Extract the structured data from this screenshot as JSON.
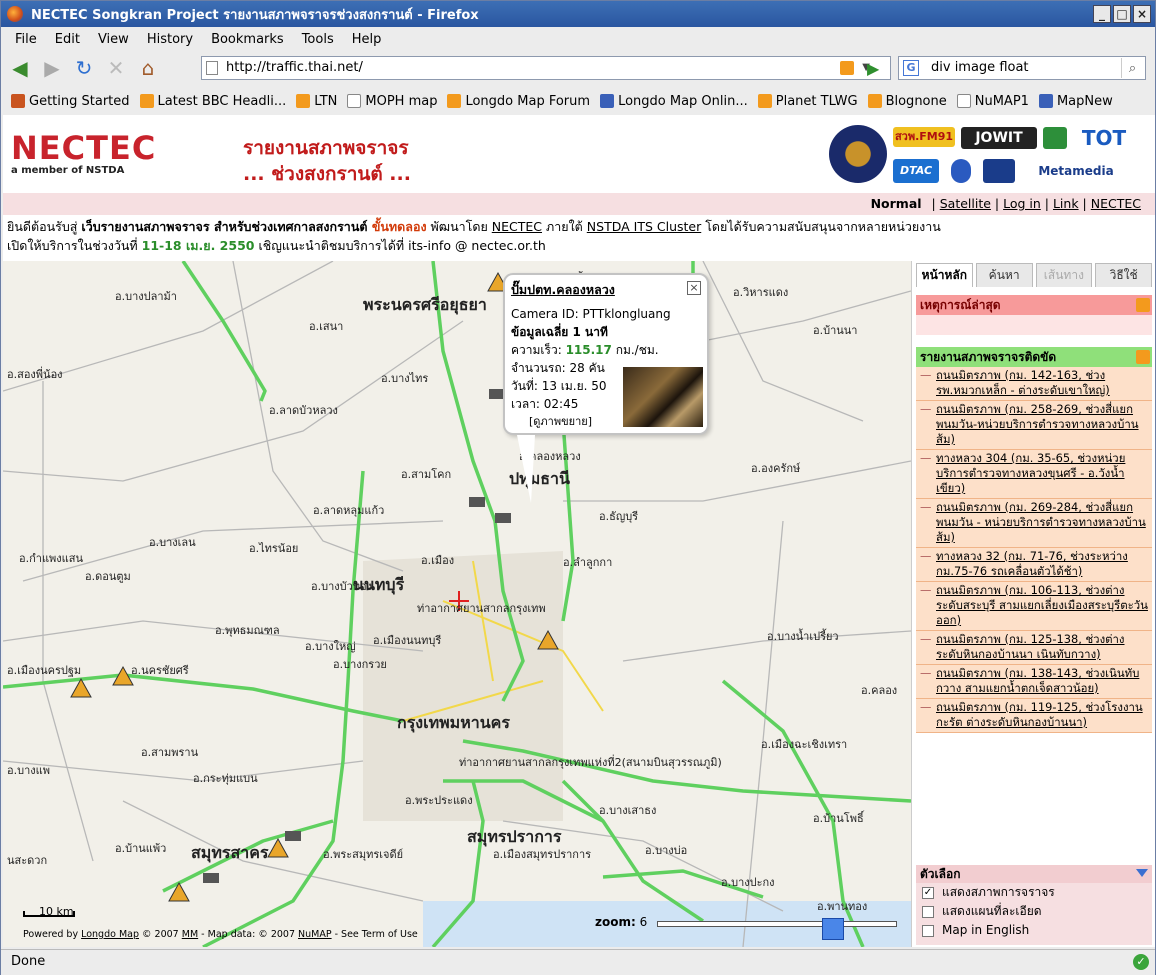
{
  "window": {
    "title": "NECTEC Songkran Project รายงานสภาพจราจรช่วงสงกรานต์ - Firefox"
  },
  "menu": [
    "File",
    "Edit",
    "View",
    "History",
    "Bookmarks",
    "Tools",
    "Help"
  ],
  "url": "http://traffic.thai.net/",
  "search_value": "div image float",
  "bookmarks": [
    {
      "label": "Getting Started",
      "icon": "ff"
    },
    {
      "label": "Latest BBC Headli...",
      "icon": "rss"
    },
    {
      "label": "LTN",
      "icon": "rss"
    },
    {
      "label": "MOPH map",
      "icon": "page"
    },
    {
      "label": "Longdo Map Forum",
      "icon": "rss"
    },
    {
      "label": "Longdo Map Onlin...",
      "icon": "lm"
    },
    {
      "label": "Planet TLWG",
      "icon": "rss"
    },
    {
      "label": "Blognone",
      "icon": "rss"
    },
    {
      "label": "NuMAP1",
      "icon": "page"
    },
    {
      "label": "MapNew",
      "icon": "lm"
    }
  ],
  "header": {
    "logo_text": "NECTEC",
    "logo_sub": "a member of NSTDA",
    "title_line1": "รายงานสภาพจราจร",
    "title_line2": "... ช่วงสงกรานต์ ...",
    "sponsors": [
      "สวพ.FM91",
      "JOWIT",
      "TOT",
      "DTAC",
      "Metamedia"
    ]
  },
  "modebar": {
    "current": "Normal",
    "links": [
      "Satellite",
      "Log in",
      "Link",
      "NECTEC"
    ]
  },
  "welcome": {
    "line1_a": "ยินดีต้อนรับสู่ ",
    "line1_b": "เว็บรายงานสภาพจราจร สำหรับช่วงเทศกาลสงกรานต์",
    "line1_c": " ขั้นทดลอง",
    "line1_d": " พัฒนาโดย ",
    "line1_e": "NECTEC",
    "line1_f": " ภายใต้ ",
    "line1_g": "NSTDA ITS Cluster",
    "line1_h": " โดยได้รับความสนับสนุนจากหลายหน่วยงาน",
    "line2_a": "เปิดให้บริการในช่วงวันที่ ",
    "line2_b": "11-18 เม.ย. 2550",
    "line2_c": " เชิญแนะนำติชมบริการได้ที่ its-info @ nectec.or.th"
  },
  "popup": {
    "title": "ปั๊มปตท.คลองหลวง",
    "camera": "Camera ID: PTTklongluang",
    "avg": "ข้อมูลเฉลี่ย 1 นาที",
    "speed_label": "ความเร็ว: ",
    "speed": "115.17",
    "speed_unit": " กม./ชม.",
    "cars": "จำนวนรถ: 28 คัน",
    "date": "วันที่: 13 เม.ย. 50",
    "time": "เวลา: 02:45",
    "enlarge": "[ดูภาพขยาย]"
  },
  "map": {
    "zoom_label": "zoom:",
    "zoom_value": "6",
    "scale": "10 km",
    "credit_a": "Powered by ",
    "credit_b": "Longdo Map",
    "credit_c": " © 2007 ",
    "credit_d": "MM",
    "credit_e": " - Map data: © 2007 ",
    "credit_f": "NuMAP",
    "credit_g": " - See Term of Use",
    "labels": [
      {
        "t": "พระนครศรีอยุธยา",
        "big": true
      },
      {
        "t": "ปทุมธานี",
        "big": true
      },
      {
        "t": "นนทบุรี",
        "big": true
      },
      {
        "t": "กรุงเทพมหานคร",
        "big": true
      },
      {
        "t": "สมุทรปราการ",
        "big": true
      },
      {
        "t": "สมุทรสาคร",
        "big": true
      },
      {
        "t": "อ.บางปลาม้า"
      },
      {
        "t": "อ.บางซ้าย"
      },
      {
        "t": "อ.เสนา"
      },
      {
        "t": "อ.สองพี่น้อง"
      },
      {
        "t": "อ.บางไทร"
      },
      {
        "t": "อ.ลาดบัวหลวง"
      },
      {
        "t": "อ.สามโคก"
      },
      {
        "t": "อ.คลองหลวง"
      },
      {
        "t": "อ.ลาดหลุมแก้ว"
      },
      {
        "t": "อ.ธัญบุรี"
      },
      {
        "t": "อ.บางเลน"
      },
      {
        "t": "อ.ไทรน้อย"
      },
      {
        "t": "อ.กำแพงแสน"
      },
      {
        "t": "อ.ดอนตูม"
      },
      {
        "t": "อ.เมือง"
      },
      {
        "t": "อ.ลำลูกกา"
      },
      {
        "t": "อ.บางบัวทอง"
      },
      {
        "t": "ท่าอากาศยานสากลกรุงเทพ"
      },
      {
        "t": "อ.พุทธมณฑล"
      },
      {
        "t": "อ.บางใหญ่"
      },
      {
        "t": "อ.เมืองนนทบุรี"
      },
      {
        "t": "อ.บางกรวย"
      },
      {
        "t": "อ.เมืองนครปฐม"
      },
      {
        "t": "อ.นครชัยศรี"
      },
      {
        "t": "อ.สามพราน"
      },
      {
        "t": "อ.กระทุ่มแบน"
      },
      {
        "t": "ท่าอากาศยานสากลกรุงเทพแห่งที่2(สนามบินสุวรรณภูมิ)"
      },
      {
        "t": "อ.พระประแดง"
      },
      {
        "t": "อ.บางเสาธง"
      },
      {
        "t": "อ.บ้านแพ้ว"
      },
      {
        "t": "อ.พระสมุทรเจดีย์"
      },
      {
        "t": "อ.เมืองสมุทรปราการ"
      },
      {
        "t": "อ.บางบ่อ"
      },
      {
        "t": "อ.บางปะกง"
      },
      {
        "t": "อ.พานทอง"
      },
      {
        "t": "อ.บ้านโพธิ์"
      },
      {
        "t": "อ.เมืองฉะเชิงเทรา"
      },
      {
        "t": "อ.บางน้ำเปรี้ยว"
      },
      {
        "t": "อ.องครักษ์"
      },
      {
        "t": "อ.วิหารแดง"
      },
      {
        "t": "อ.บ้านนา"
      },
      {
        "t": "อ.คลอง"
      },
      {
        "t": "อ.บางแพ"
      },
      {
        "t": "นสะดวก"
      }
    ]
  },
  "sidebar": {
    "tabs": [
      "หน้าหลัก",
      "ค้นหา",
      "เส้นทาง",
      "วิธีใช้"
    ],
    "incidents_title": "เหตุการณ์ล่าสุด",
    "traffic_title": "รายงานสภาพจราจรติดขัด",
    "traffic_items": [
      "ถนนมิตรภาพ (กม. 142-163, ช่วง รพ.หมวกเหล็ก - ต่างระดับเขาใหญ่)",
      "ถนนมิตรภาพ (กม. 258-269, ช่วงสี่แยกพนมวัน-หน่วยบริการตำรวจทางหลวงบ้านส้ม)",
      "ทางหลวง 304 (กม. 35-65, ช่วงหน่วยบริการตำรวจทางหลวงขุนศรี - อ.วังน้ำเขียว)",
      "ถนนมิตรภาพ (กม. 269-284, ช่วงสี่แยกพนมวัน - หน่วยบริการตำรวจทางหลวงบ้านส้ม)",
      "ทางหลวง 32 (กม. 71-76, ช่วงระหว่าง กม.75-76 รถเคลื่อนตัวได้ช้า)",
      "ถนนมิตรภาพ (กม. 106-113, ช่วงต่างระดับสระบุรี สามแยกเลี่ยงเมืองสระบุรีตะวันออก)",
      "ถนนมิตรภาพ (กม. 125-138, ช่วงต่างระดับหินกองบ้านนา เนินทับกวาง)",
      "ถนนมิตรภาพ (กม. 138-143, ช่วงเนินทับกวาง สามแยกน้ำตกเจ็ดสาวน้อย)",
      "ถนนมิตรภาพ (กม. 119-125, ช่วงโรงงานกะรัต ต่างระดับหินกองบ้านนา)"
    ],
    "options_title": "ตัวเลือก",
    "options": [
      {
        "label": "แสดงสภาพการจราจร",
        "checked": true
      },
      {
        "label": "แสดงแผนที่ละเอียด",
        "checked": false
      },
      {
        "label": "Map in English",
        "checked": false
      }
    ]
  },
  "status": "Done"
}
